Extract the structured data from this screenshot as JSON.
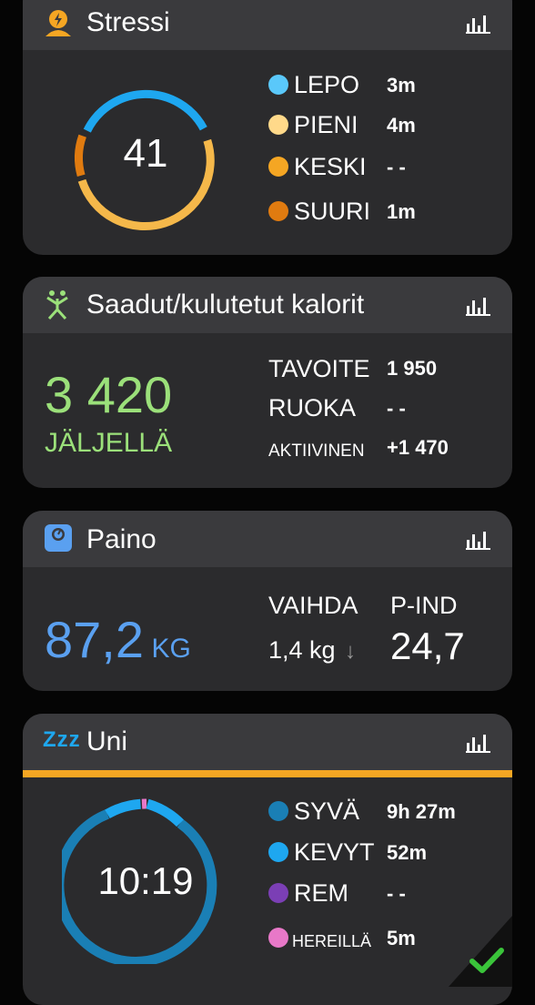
{
  "stress": {
    "title": "Stressi",
    "score": "41",
    "legend": [
      {
        "label": "LEPO",
        "value": "3m",
        "color": "#5ac8fa"
      },
      {
        "label": "PIENI",
        "value": "4m",
        "color": "#ffd98a"
      },
      {
        "label": "KESKI",
        "value": "- -",
        "color": "#f5a623"
      },
      {
        "label": "SUURI",
        "value": "1m",
        "color": "#e07b10"
      }
    ]
  },
  "calories": {
    "title": "Saadut/kulutetut kalorit",
    "remaining_value": "3 420",
    "remaining_label": "JÄLJELLÄ",
    "rows": [
      {
        "label": "TAVOITE",
        "value": "1 950"
      },
      {
        "label": "RUOKA",
        "value": "- -"
      },
      {
        "label": "AKTIIVINEN",
        "value": "+1 470"
      }
    ]
  },
  "weight": {
    "title": "Paino",
    "value": "87,2",
    "unit": "KG",
    "change_label": "VAIHDA",
    "change_value": "1,4 kg",
    "change_arrow": "↓",
    "bmi_label": "P-IND",
    "bmi_value": "24,7"
  },
  "sleep": {
    "title": "Uni",
    "zzz": "Zzz",
    "duration": "10:19",
    "legend": [
      {
        "label": "SYVÄ",
        "value": "9h 27m",
        "color": "#1a7fb5"
      },
      {
        "label": "KEVYT",
        "value": "52m",
        "color": "#1ea7f0"
      },
      {
        "label": "REM",
        "value": "- -",
        "color": "#7b3fb5"
      },
      {
        "label": "HEREILLÄ",
        "value": "5m",
        "color": "#e878c8"
      }
    ]
  },
  "colors": {
    "card_bg": "#2b2b2d",
    "card_header": "#3a3a3d",
    "calories_green": "#9be07a",
    "weight_blue": "#5aa0f0",
    "sleep_bar": "#f5a623",
    "check_green": "#3ac43a"
  }
}
